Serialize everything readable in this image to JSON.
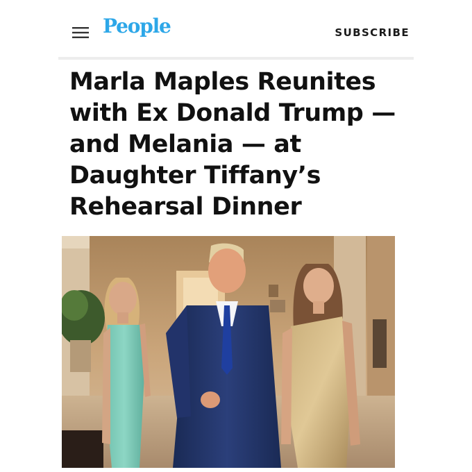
{
  "header": {
    "logo": "People",
    "subscribe_label": "SUBSCRIBE",
    "menu_icon": "hamburger-menu-icon",
    "brand_color": "#2da7e8"
  },
  "article": {
    "headline": "Marla Maples Reunites with Ex Donald Trump — and Melania — at Daughter Tiffany’s Rehearsal Dinner"
  }
}
